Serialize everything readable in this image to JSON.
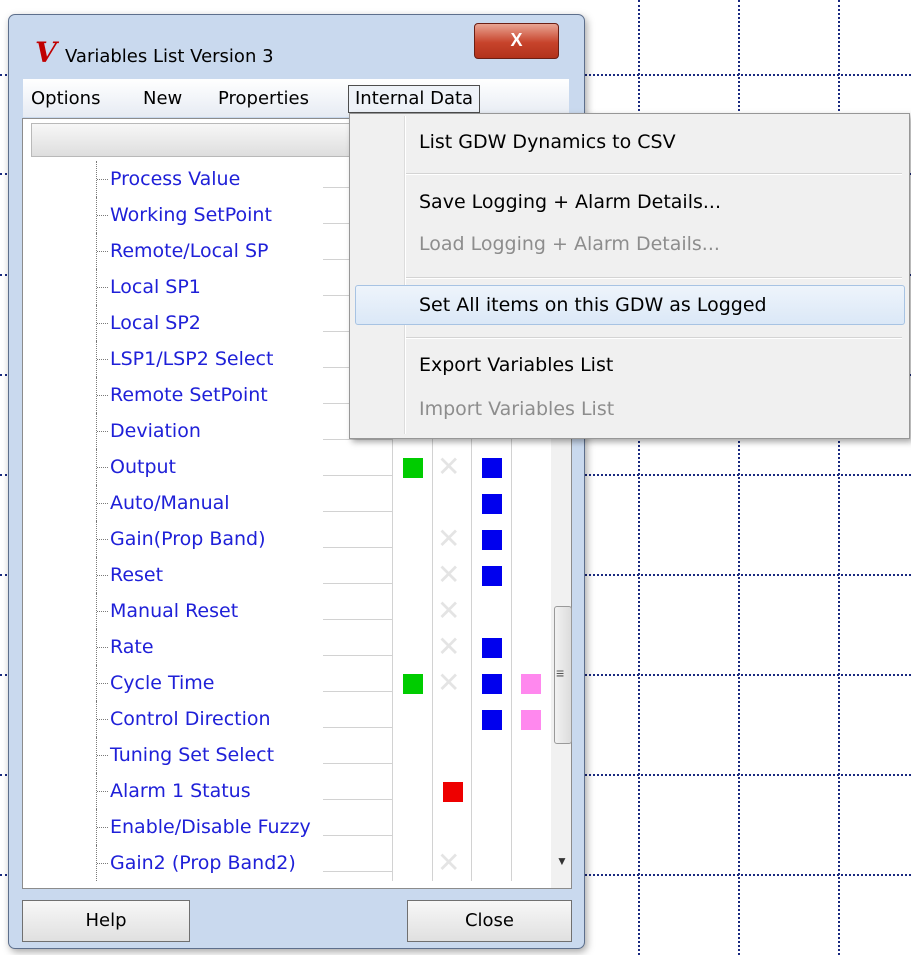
{
  "window": {
    "title": "Variables List Version 3",
    "close_glyph": "X",
    "app_icon_glyph": "V"
  },
  "menubar": {
    "items": [
      "Options",
      "New",
      "Properties",
      "Internal Data"
    ],
    "active": "Internal Data"
  },
  "dropdown": {
    "items": [
      {
        "label": "List GDW Dynamics to CSV",
        "enabled": true
      },
      {
        "label": "Save Logging + Alarm Details...",
        "enabled": true
      },
      {
        "label": "Load Logging + Alarm Details...",
        "enabled": false
      },
      {
        "label": "Set All items on this GDW as Logged",
        "enabled": true,
        "highlighted": true
      },
      {
        "label": "Export Variables List",
        "enabled": true
      },
      {
        "label": "Import Variables List",
        "enabled": false
      }
    ]
  },
  "variables": {
    "rows": [
      {
        "label": "Process Value",
        "cells": [
          "",
          "",
          "",
          ""
        ]
      },
      {
        "label": "Working SetPoint",
        "cells": [
          "",
          "",
          "",
          ""
        ]
      },
      {
        "label": "Remote/Local SP",
        "cells": [
          "",
          "",
          "",
          ""
        ]
      },
      {
        "label": "Local SP1",
        "cells": [
          "",
          "",
          "",
          ""
        ]
      },
      {
        "label": "Local SP2",
        "cells": [
          "",
          "",
          "",
          ""
        ]
      },
      {
        "label": "LSP1/LSP2 Select",
        "cells": [
          "",
          "",
          "",
          ""
        ]
      },
      {
        "label": "Remote SetPoint",
        "cells": [
          "",
          "",
          "",
          ""
        ]
      },
      {
        "label": "Deviation",
        "cells": [
          "",
          "",
          "",
          ""
        ]
      },
      {
        "label": "Output",
        "cells": [
          "green",
          "x",
          "blue",
          ""
        ]
      },
      {
        "label": "Auto/Manual",
        "cells": [
          "",
          "",
          "blue",
          ""
        ]
      },
      {
        "label": "Gain(Prop Band)",
        "cells": [
          "",
          "x",
          "blue",
          ""
        ]
      },
      {
        "label": "Reset",
        "cells": [
          "",
          "x",
          "blue",
          ""
        ]
      },
      {
        "label": "Manual Reset",
        "cells": [
          "",
          "x",
          "",
          ""
        ]
      },
      {
        "label": "Rate",
        "cells": [
          "",
          "x",
          "blue",
          ""
        ]
      },
      {
        "label": "Cycle Time",
        "cells": [
          "green",
          "x",
          "blue",
          "pink"
        ]
      },
      {
        "label": "Control Direction",
        "cells": [
          "",
          "",
          "blue",
          "pink"
        ]
      },
      {
        "label": "Tuning Set Select",
        "cells": [
          "",
          "",
          "",
          ""
        ]
      },
      {
        "label": "Alarm 1 Status",
        "cells": [
          "",
          "red",
          "",
          ""
        ]
      },
      {
        "label": "Enable/Disable Fuzzy",
        "cells": [
          "",
          "",
          "",
          ""
        ]
      },
      {
        "label": "Gain2 (Prop Band2)",
        "cells": [
          "",
          "x",
          "",
          ""
        ]
      }
    ]
  },
  "footer": {
    "help_label": "Help",
    "close_label": "Close"
  },
  "colors": {
    "green": "#00cc00",
    "blue": "#0000ee",
    "pink": "#ff88ee",
    "red": "#ee0000",
    "label": "#1f20d8"
  }
}
